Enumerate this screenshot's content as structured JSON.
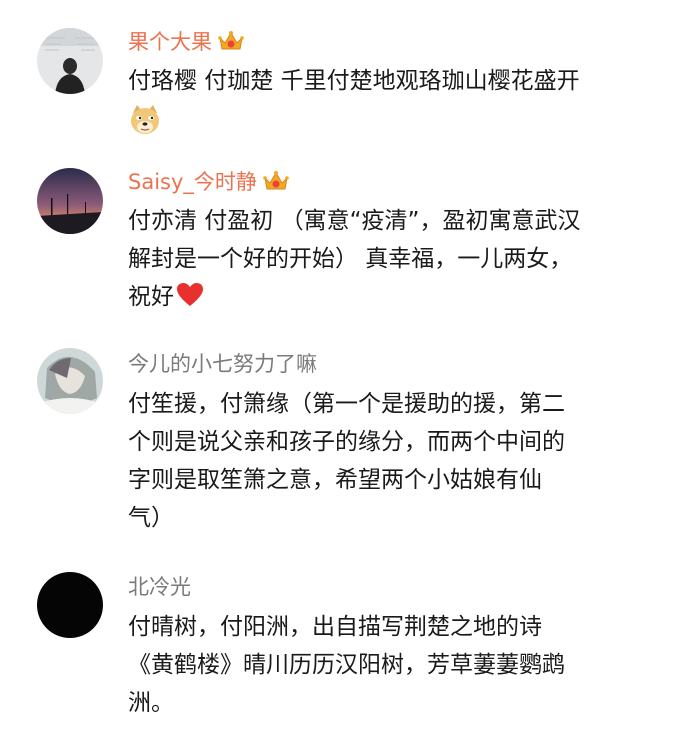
{
  "comments": [
    {
      "username": "果个大果",
      "lines": [
        "付珞樱 付珈楚 千里付楚地观珞珈山樱花盛开"
      ],
      "emoji": "doge-emoji",
      "vip": true
    },
    {
      "username": "Saisy_今时静",
      "lines": [
        "付亦清 付盈初 （寓意“疫清”，盈初寓意武汉",
        "解封是一个好的开始） 真幸福，一儿两女，",
        "祝好"
      ],
      "emoji": "heart-emoji",
      "vip": true
    },
    {
      "username": "今儿的小七努力了嘛",
      "lines": [
        "付笙援，付箫缘（第一个是援助的援，第二",
        "个则是说父亲和孩子的缘分，而两个中间的",
        "字则是取笙箫之意，希望两个小姑娘有仙",
        "气）"
      ],
      "vip": false
    },
    {
      "username": "北冷光",
      "lines": [
        "付晴树，付阳洲，出自描写荆楚之地的诗",
        "《黄鹤楼》晴川历历汉阳树，芳草萋萋鹦鹉",
        "洲。"
      ],
      "vip": false
    }
  ],
  "colors": {
    "vip_name": "#eb7350",
    "normal_name": "#7a7a7a",
    "text": "#1a1a1a",
    "crown": "#f5a623"
  },
  "icons": [
    "vip-crown-icon",
    "doge-emoji",
    "heart-emoji"
  ]
}
